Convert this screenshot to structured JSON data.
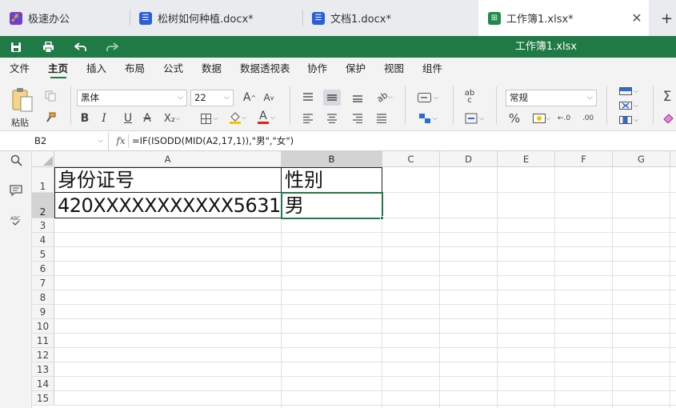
{
  "tabs": [
    {
      "label": "极速办公",
      "icon": "rocket-icon"
    },
    {
      "label": "松树如何种植.docx*",
      "icon": "doc-icon"
    },
    {
      "label": "文档1.docx*",
      "icon": "doc-icon"
    },
    {
      "label": "工作簿1.xlsx*",
      "icon": "sheet-icon"
    }
  ],
  "window": {
    "title": "工作簿1.xlsx",
    "accent": "#1f7a45"
  },
  "menu": [
    "文件",
    "主页",
    "插入",
    "布局",
    "公式",
    "数据",
    "数据透视表",
    "协作",
    "保护",
    "视图",
    "组件"
  ],
  "ribbon": {
    "paste_label": "粘贴",
    "font_name": "黑体",
    "font_size": "22",
    "number_format": "常规",
    "bold": "B",
    "italic": "I",
    "underline": "U",
    "strike": "A",
    "subscript": "X₂",
    "font_color_glyph": "A",
    "percent": "%",
    "sigma": "Σ"
  },
  "formula_bar": {
    "name_box": "B2",
    "fx": "fx",
    "formula": "=IF(ISODD(MID(A2,17,1)),\"男\",\"女\")"
  },
  "columns": [
    "A",
    "B",
    "C",
    "D",
    "E",
    "F",
    "G"
  ],
  "rows": [
    "1",
    "2",
    "3",
    "4",
    "5",
    "6",
    "7",
    "8",
    "9",
    "10",
    "11",
    "12",
    "13",
    "14",
    "15"
  ],
  "cells": {
    "A1": "身份证号",
    "B1": "性别",
    "A2": "420XXXXXXXXXXX5631",
    "B2": "男"
  },
  "selected_cell": "B2"
}
